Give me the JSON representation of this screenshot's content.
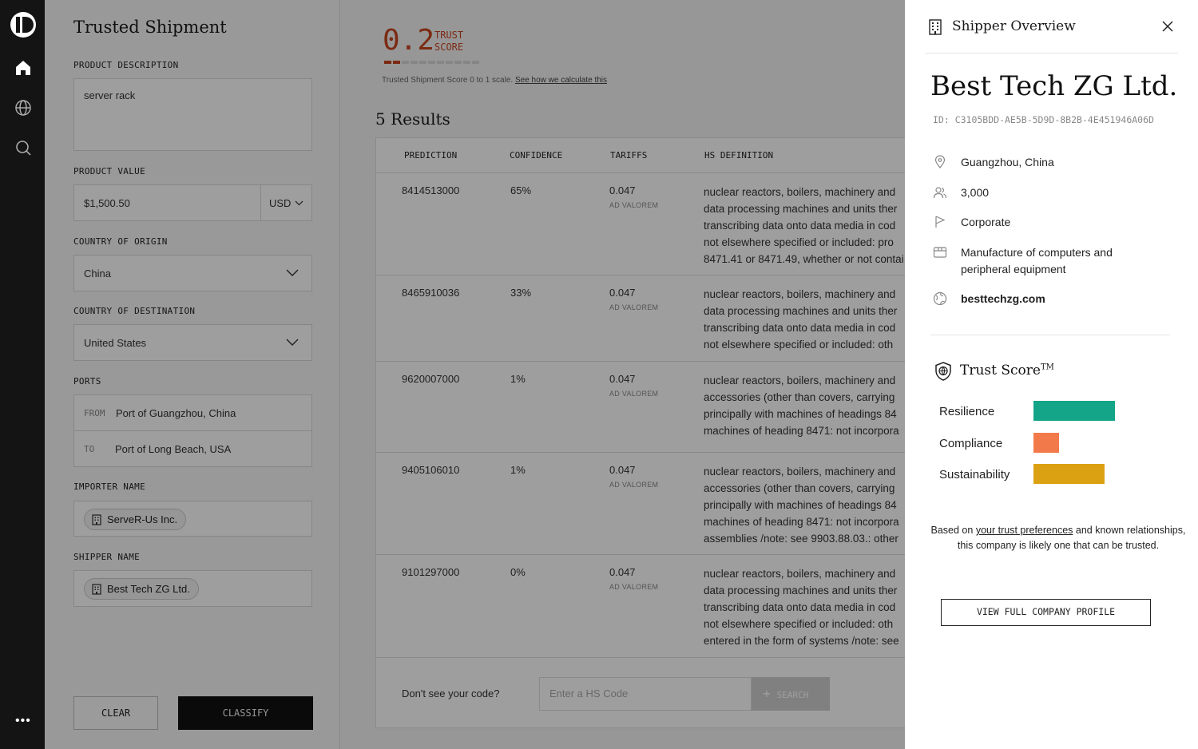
{
  "form": {
    "title": "Trusted Shipment",
    "product_description_label": "PRODUCT DESCRIPTION",
    "product_description_value": "server rack",
    "product_value_label": "PRODUCT VALUE",
    "product_value": "$1,500.50",
    "currency": "USD",
    "origin_label": "COUNTRY OF ORIGIN",
    "origin_value": "China",
    "destination_label": "COUNTRY OF DESTINATION",
    "destination_value": "United States",
    "ports_label": "PORTS",
    "port_from_tag": "FROM",
    "port_from": "Port of Guangzhou, China",
    "port_to_tag": "TO",
    "port_to": "Port of Long Beach, USA",
    "importer_label": "IMPORTER NAME",
    "importer": "ServeR-Us Inc.",
    "shipper_label": "SHIPPER NAME",
    "shipper": "Best Tech ZG Ltd.",
    "clear_label": "CLEAR",
    "classify_label": "CLASSIFY"
  },
  "score": {
    "value": "0.2",
    "label_line1": "TRUST",
    "label_line2": "SCORE",
    "bar_filled": 2,
    "bar_total": 11,
    "note": "Trusted Shipment Score 0 to 1 scale.",
    "note_link": "See how we calculate this"
  },
  "results": {
    "heading": "5 Results",
    "headers": [
      "PREDICTION",
      "CONFIDENCE",
      "TARIFFS",
      "HS DEFINITION"
    ],
    "tariff_sub": "AD VALOREM",
    "rows": [
      {
        "code": "8414513000",
        "confidence": "65%",
        "tariff": "0.047",
        "definition": [
          "nuclear reactors, boilers, machinery and",
          "data processing machines and units ther",
          "transcribing data onto data media in cod",
          "not elsewhere specified or included: pro",
          "8471.41 or 8471.49, whether or not contai"
        ]
      },
      {
        "code": "8465910036",
        "confidence": "33%",
        "tariff": "0.047",
        "definition": [
          "nuclear reactors, boilers, machinery and",
          "data processing machines and units ther",
          "transcribing data onto data media in cod",
          "not elsewhere specified or included: oth"
        ]
      },
      {
        "code": "9620007000",
        "confidence": "1%",
        "tariff": "0.047",
        "definition": [
          "nuclear reactors, boilers, machinery and",
          "accessories (other than covers, carrying",
          "principally with machines of headings 84",
          "machines of heading 8471: not incorpora"
        ]
      },
      {
        "code": "9405106010",
        "confidence": "1%",
        "tariff": "0.047",
        "definition": [
          "nuclear reactors, boilers, machinery and",
          "accessories (other than covers, carrying",
          "principally with machines of headings 84",
          "machines of heading 8471: not incorpora",
          "assemblies /note: see 9903.88.03.: other"
        ]
      },
      {
        "code": "9101297000",
        "confidence": "0%",
        "tariff": "0.047",
        "definition": [
          "nuclear reactors, boilers, machinery and",
          "data processing machines and units ther",
          "transcribing data onto data media in cod",
          "not elsewhere specified or included: oth",
          "entered in the form of systems /note: see"
        ]
      }
    ],
    "footer_question": "Don't see your code?",
    "hs_placeholder": "Enter a HS Code",
    "search_label": "SEARCH"
  },
  "drawer": {
    "title": "Shipper Overview",
    "company": "Best Tech ZG Ltd.",
    "id": "ID: C3105BDD-AE5B-5D9D-8B2B-4E451946A06D",
    "location": "Guangzhou, China",
    "employees": "3,000",
    "type": "Corporate",
    "industry_line1": "Manufacture of computers and",
    "industry_line2": "peripheral equipment",
    "website": "besttechzg.com",
    "trust_title": "Trust Score",
    "trust_tm": "TM",
    "metrics": [
      {
        "name": "Resilience",
        "level": 1.0,
        "color": "#14a589"
      },
      {
        "name": "Compliance",
        "level": 0.31,
        "color": "#f27a4a"
      },
      {
        "name": "Sustainability",
        "level": 0.87,
        "color": "#dca013"
      }
    ],
    "note_pre": "Based on ",
    "note_link": "your trust preferences",
    "note_post": " and known relationships, this company is likely one that can be trusted.",
    "profile_button": "VIEW FULL COMPANY PROFILE"
  }
}
